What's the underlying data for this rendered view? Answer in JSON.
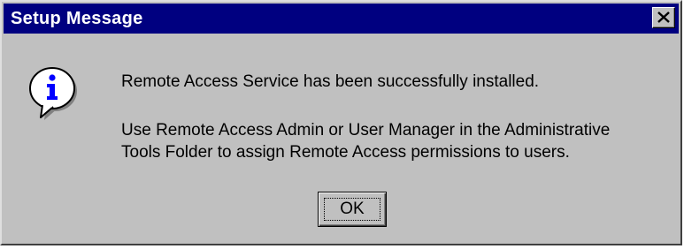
{
  "window": {
    "title": "Setup Message",
    "close_icon": "close-x-icon"
  },
  "message": {
    "icon": "information-icon",
    "line1": "Remote Access Service has been successfully installed.",
    "line2": "Use Remote Access Admin or User Manager in the Administrative",
    "line3": "Tools Folder to assign Remote Access permissions to users."
  },
  "buttons": {
    "ok_label": "OK"
  },
  "colors": {
    "titlebar": "#000080",
    "face": "#c0c0c0",
    "icon_blue": "#0000ff"
  }
}
